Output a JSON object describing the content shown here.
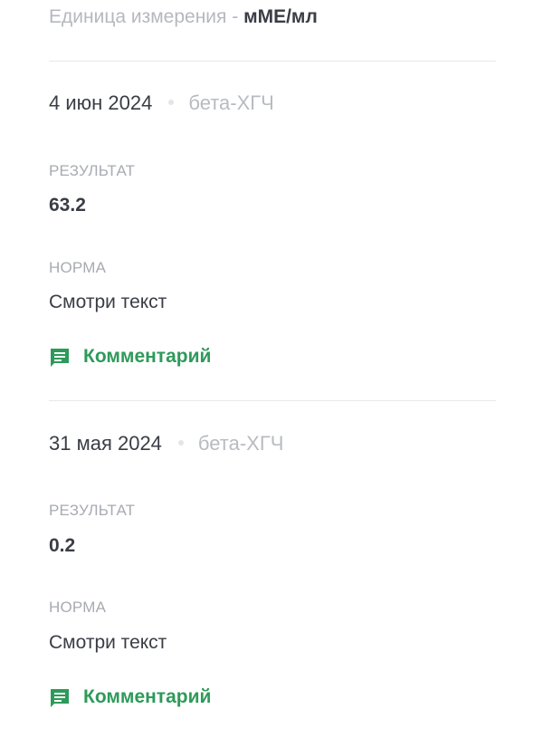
{
  "unit": {
    "prefix": "Единица измерения - ",
    "value": "мМЕ/мл"
  },
  "entries": [
    {
      "date": "4 июн 2024",
      "test_name": "бета-ХГЧ",
      "result_label": "РЕЗУЛЬТАТ",
      "result_value": "63.2",
      "norm_label": "НОРМА",
      "norm_value": "Смотри текст",
      "comment_label": "Комментарий"
    },
    {
      "date": "31 мая 2024",
      "test_name": "бета-ХГЧ",
      "result_label": "РЕЗУЛЬТАТ",
      "result_value": "0.2",
      "norm_label": "НОРМА",
      "norm_value": "Смотри текст",
      "comment_label": "Комментарий"
    }
  ],
  "colors": {
    "accent": "#2e9a5a",
    "text": "#3a3d45",
    "muted": "#a8abb2",
    "divider": "#e6e8eb"
  },
  "icons": {
    "comment": "comment-icon"
  }
}
